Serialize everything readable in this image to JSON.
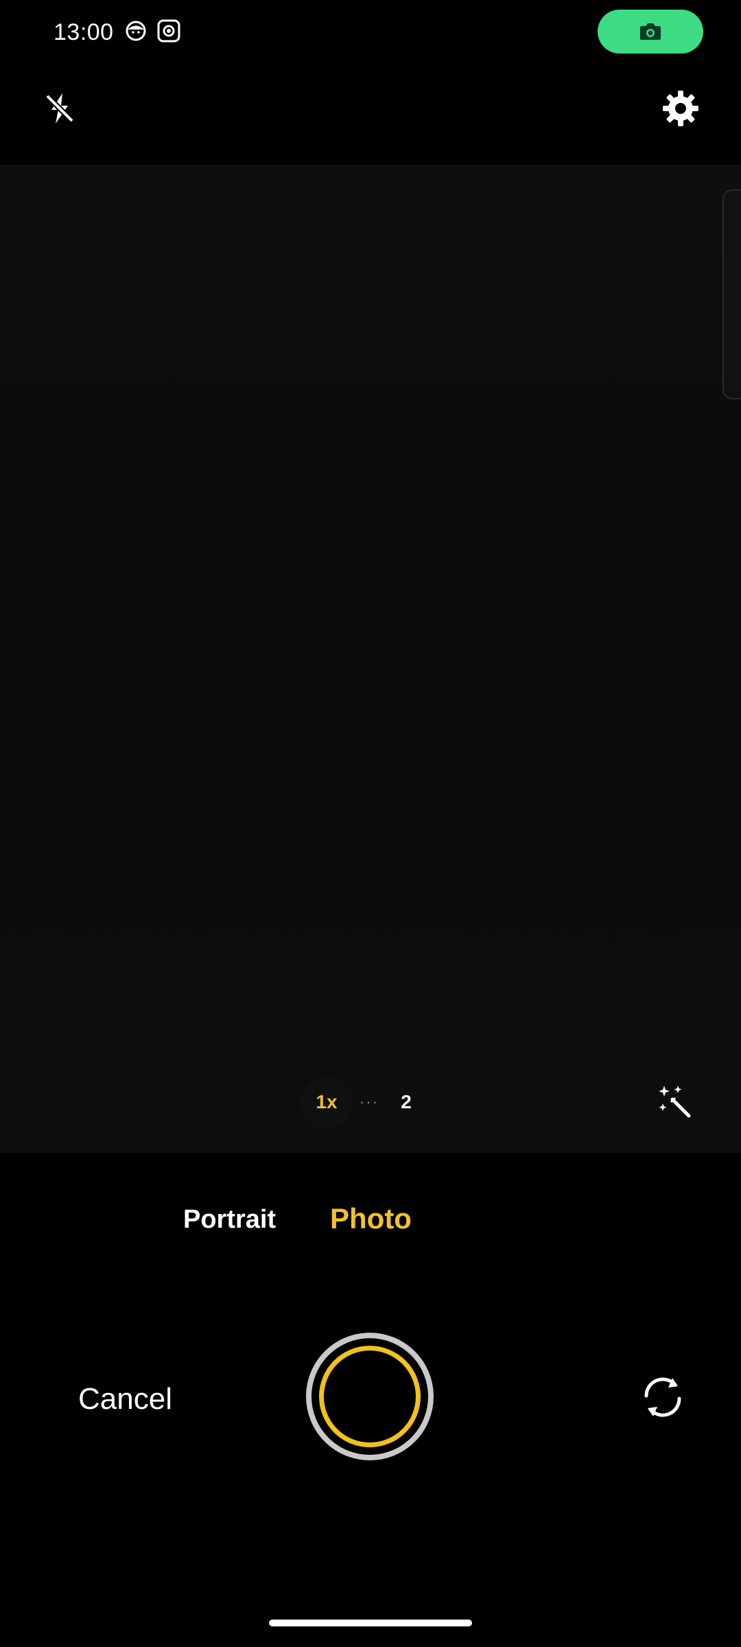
{
  "status_bar": {
    "time": "13:00",
    "icons": [
      "face-app-icon",
      "screen-record-icon"
    ],
    "pill_icon": "camera-icon",
    "pill_color": "#3ddc84"
  },
  "top_controls": {
    "flash_icon": "flash-off-icon",
    "settings_icon": "gear-icon"
  },
  "zoom": {
    "active": "1x",
    "dots": "···",
    "option": "2"
  },
  "modes": {
    "portrait": "Portrait",
    "photo": "Photo",
    "selected": "Photo"
  },
  "bottom_controls": {
    "cancel_label": "Cancel",
    "shutter_icon": "shutter-button",
    "switch_icon": "switch-camera-icon"
  },
  "colors": {
    "accent": "#f4c12c",
    "shutter_ring": "#c9c9c9"
  }
}
